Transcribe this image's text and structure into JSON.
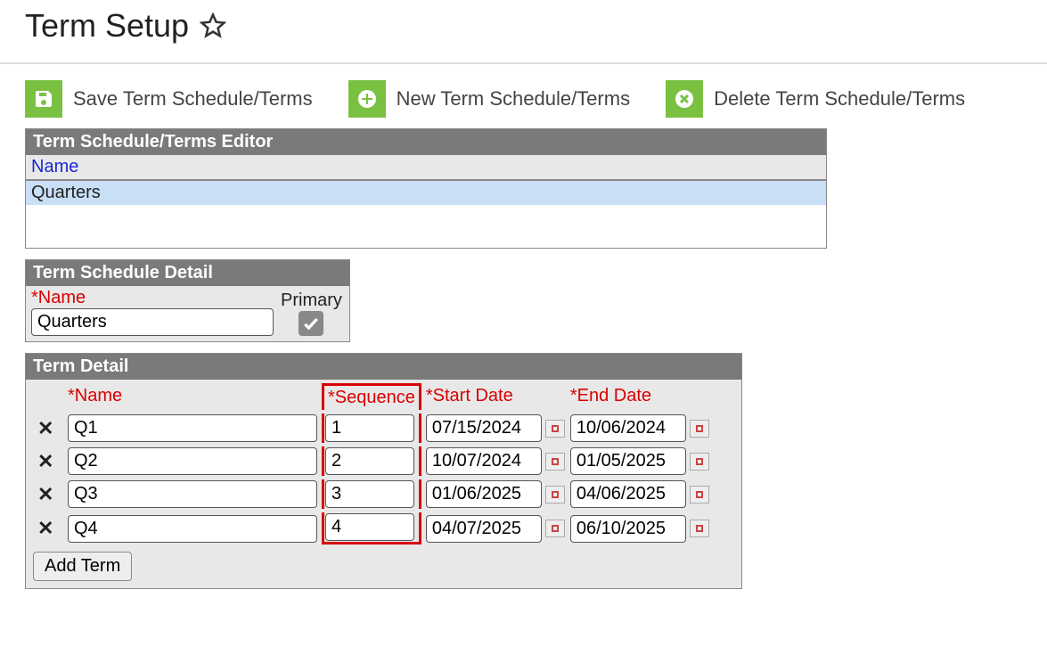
{
  "page": {
    "title": "Term Setup"
  },
  "toolbar": {
    "save_label": "Save Term Schedule/Terms",
    "new_label": "New Term Schedule/Terms",
    "delete_label": "Delete Term Schedule/Terms"
  },
  "editor": {
    "panel_title": "Term Schedule/Terms Editor",
    "col_name": "Name",
    "rows": [
      {
        "name": "Quarters"
      }
    ]
  },
  "schedule_detail": {
    "panel_title": "Term Schedule Detail",
    "name_label": "*Name",
    "name_value": "Quarters",
    "primary_label": "Primary",
    "primary_checked": true
  },
  "term_detail": {
    "panel_title": "Term Detail",
    "col_name": "*Name",
    "col_sequence": "*Sequence",
    "col_start": "*Start Date",
    "col_end": "*End Date",
    "add_term_label": "Add Term",
    "rows": [
      {
        "name": "Q1",
        "sequence": "1",
        "start": "07/15/2024",
        "end": "10/06/2024"
      },
      {
        "name": "Q2",
        "sequence": "2",
        "start": "10/07/2024",
        "end": "01/05/2025"
      },
      {
        "name": "Q3",
        "sequence": "3",
        "start": "01/06/2025",
        "end": "04/06/2025"
      },
      {
        "name": "Q4",
        "sequence": "4",
        "start": "04/07/2025",
        "end": "06/10/2025"
      }
    ]
  }
}
